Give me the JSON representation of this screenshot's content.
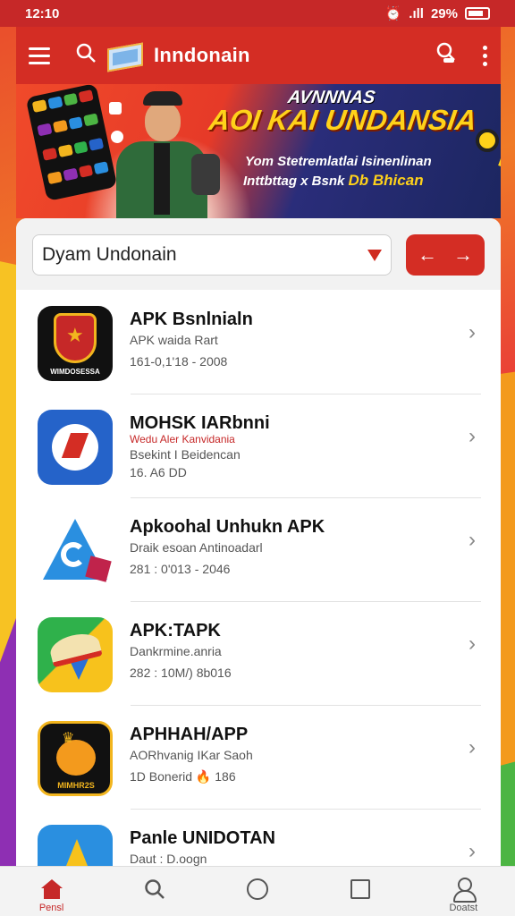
{
  "status_bar": {
    "time": "12:10",
    "signal": ".ıll",
    "battery": "29%"
  },
  "app_bar": {
    "title": "Inndonain",
    "icons": [
      "menu-icon",
      "search-icon",
      "account-search-icon",
      "more-vert-icon"
    ]
  },
  "banner": {
    "headline_small": "AVNNNAS",
    "headline_left": "AOI",
    "headline_main": "KAI UNDANSIA",
    "line1": "Yom Stetremlatlai Isinenlinan",
    "line2": "Inttbttag x Bsnk",
    "line2_highlight": "Db Bhican"
  },
  "filter": {
    "dropdown_value": "Dyam Undonain",
    "swap_left": "←",
    "swap_right": "→"
  },
  "apps": [
    {
      "name": "APK Bsnlnialn",
      "sub": "APK waida Rart",
      "meta": "161-0,1'18  -  2008",
      "icon": "shield-app-icon",
      "icon_label": "WIMDOSESSA"
    },
    {
      "name": "MOHSK IARbnni",
      "sub": "Bsekint I Beidencan",
      "meta": "16. A6 DD",
      "icon": "blue-circle-app-icon",
      "sub_red": "Wedu Aler Kanvidania"
    },
    {
      "name": "Apkoohal Unhukn APK",
      "sub": "Draik esoan Antinoadarl",
      "meta": "281 : 0'013  -  2046",
      "icon": "triangle-app-icon"
    },
    {
      "name": "APK:TAPK",
      "sub": "Dankrmine.anria",
      "meta": "282 : 10M/)  8b016",
      "icon": "hat-app-icon"
    },
    {
      "name": "APHHAH/APP",
      "sub": "AORhvanig IKar Saoh",
      "meta": "1D Bonerid   🔥 186",
      "icon": "mascot-app-icon",
      "icon_label": "MIMHR2S"
    },
    {
      "name": "Panle UNIDOTAN",
      "sub": "Daut : D.oogn",
      "meta": "",
      "icon": "arrow-app-icon"
    }
  ],
  "bottom_nav": [
    {
      "label": "Pensl",
      "icon": "home-icon",
      "active": true
    },
    {
      "label": "",
      "icon": "search-icon",
      "active": false
    },
    {
      "label": "",
      "icon": "circle-icon",
      "active": false
    },
    {
      "label": "",
      "icon": "square-icon",
      "active": false
    },
    {
      "label": "Doatst",
      "icon": "profile-icon",
      "active": false
    }
  ],
  "colors": {
    "brand_red": "#d42d24",
    "status_red": "#c62828"
  }
}
